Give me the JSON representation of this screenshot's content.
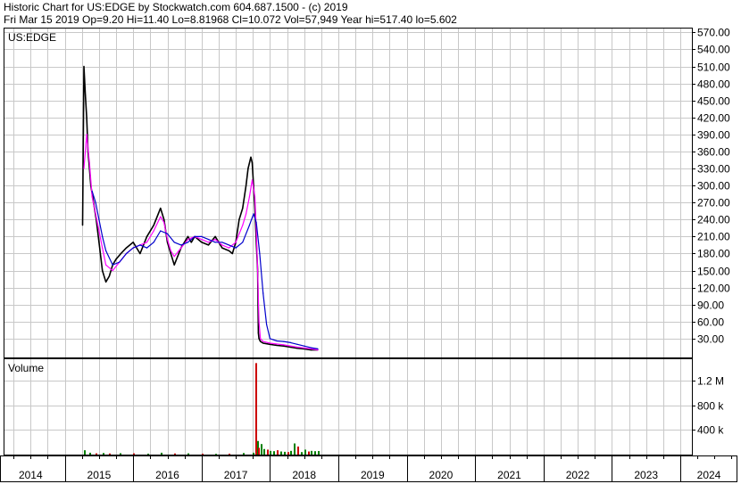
{
  "header": {
    "line1": "Historic Chart for US:EDGE by Stockwatch.com 604.687.1500 - (c) 2019",
    "line2": "Fri Mar 15 2019   Op=9.20   Hi=11.40   Lo=8.81968   Cl=10.072   Vol=57,949   Year hi=517.40   lo=5.602"
  },
  "chart_data": {
    "type": "line",
    "symbol_label": "US:EDGE",
    "volume_label": "Volume",
    "price_ticks": [
      "570.00",
      "540.00",
      "510.00",
      "480.00",
      "450.00",
      "420.00",
      "390.00",
      "360.00",
      "330.00",
      "300.00",
      "270.00",
      "240.00",
      "210.00",
      "180.00",
      "150.00",
      "120.00",
      "90.00",
      "60.00",
      "30.00"
    ],
    "volume_ticks": [
      "1.2 M",
      "800 k",
      "400 k"
    ],
    "year_labels": [
      "2014",
      "2015",
      "2016",
      "2017",
      "2018",
      "2019",
      "2020",
      "2021",
      "2022",
      "2023",
      "2024"
    ],
    "price_ylim": [
      0,
      585
    ],
    "volume_ylim": [
      0,
      1500000
    ],
    "grid": true,
    "colors": {
      "price": "#000000",
      "ma_short": "#ff00ff",
      "ma_long": "#0000cc",
      "vol_up": "#008000",
      "vol_down": "#cc0000",
      "grid": "#c8c8c8"
    },
    "series": [
      {
        "key": "close",
        "x": [
          2015.26,
          2015.28,
          2015.3,
          2015.32,
          2015.34,
          2015.36,
          2015.38,
          2015.42,
          2015.46,
          2015.5,
          2015.55,
          2015.6,
          2015.65,
          2015.7,
          2015.75,
          2015.82,
          2015.9,
          2016.0,
          2016.1,
          2016.2,
          2016.3,
          2016.4,
          2016.45,
          2016.5,
          2016.55,
          2016.6,
          2016.7,
          2016.8,
          2016.85,
          2016.9,
          2017.0,
          2017.1,
          2017.2,
          2017.3,
          2017.4,
          2017.45,
          2017.5,
          2017.55,
          2017.6,
          2017.65,
          2017.68,
          2017.72,
          2017.74,
          2017.76,
          2017.78,
          2017.8,
          2017.82,
          2017.83,
          2017.84,
          2017.86,
          2017.9,
          2018.0,
          2018.1,
          2018.2,
          2018.3,
          2018.4,
          2018.5,
          2018.6,
          2018.7
        ],
        "values": [
          230,
          510,
          460,
          420,
          360,
          330,
          300,
          270,
          240,
          200,
          150,
          130,
          140,
          160,
          170,
          180,
          190,
          200,
          180,
          210,
          230,
          260,
          240,
          200,
          180,
          160,
          190,
          210,
          200,
          210,
          200,
          195,
          210,
          190,
          185,
          180,
          200,
          240,
          260,
          300,
          330,
          350,
          340,
          300,
          260,
          200,
          150,
          40,
          30,
          25,
          22,
          20,
          18,
          17,
          15,
          13,
          12,
          10,
          10
        ]
      },
      {
        "key": "ma_short",
        "x": [
          2015.28,
          2015.32,
          2015.36,
          2015.4,
          2015.45,
          2015.5,
          2015.55,
          2015.6,
          2015.7,
          2015.8,
          2015.9,
          2016.0,
          2016.1,
          2016.2,
          2016.3,
          2016.4,
          2016.45,
          2016.5,
          2016.55,
          2016.6,
          2016.7,
          2016.8,
          2016.9,
          2017.0,
          2017.1,
          2017.2,
          2017.3,
          2017.4,
          2017.5,
          2017.6,
          2017.65,
          2017.7,
          2017.74,
          2017.78,
          2017.8,
          2017.82,
          2017.84,
          2017.86,
          2017.9,
          2018.0,
          2018.2,
          2018.4,
          2018.6,
          2018.7
        ],
        "values": [
          330,
          390,
          340,
          280,
          250,
          220,
          190,
          160,
          150,
          165,
          180,
          190,
          195,
          200,
          220,
          245,
          235,
          205,
          185,
          175,
          190,
          205,
          210,
          205,
          200,
          205,
          195,
          190,
          200,
          230,
          250,
          280,
          310,
          280,
          220,
          150,
          60,
          30,
          25,
          22,
          19,
          15,
          12,
          10
        ]
      },
      {
        "key": "ma_long",
        "x": [
          2015.4,
          2015.45,
          2015.5,
          2015.55,
          2015.6,
          2015.7,
          2015.8,
          2015.9,
          2016.0,
          2016.1,
          2016.2,
          2016.3,
          2016.4,
          2016.5,
          2016.6,
          2016.7,
          2016.8,
          2016.9,
          2017.0,
          2017.1,
          2017.2,
          2017.3,
          2017.4,
          2017.5,
          2017.6,
          2017.7,
          2017.76,
          2017.8,
          2017.85,
          2017.9,
          2017.95,
          2018.0,
          2018.1,
          2018.2,
          2018.3,
          2018.4,
          2018.5,
          2018.6,
          2018.7
        ],
        "values": [
          290,
          270,
          240,
          210,
          185,
          160,
          165,
          180,
          190,
          195,
          190,
          200,
          220,
          215,
          200,
          195,
          200,
          210,
          210,
          205,
          200,
          200,
          195,
          190,
          200,
          230,
          250,
          235,
          180,
          110,
          55,
          30,
          26,
          25,
          23,
          20,
          17,
          14,
          12
        ]
      }
    ],
    "volume": {
      "x": [
        2015.28,
        2015.36,
        2015.45,
        2015.55,
        2015.65,
        2015.8,
        2016.0,
        2016.2,
        2016.4,
        2016.6,
        2016.8,
        2017.0,
        2017.2,
        2017.4,
        2017.6,
        2017.75,
        2017.79,
        2017.81,
        2017.83,
        2017.86,
        2017.9,
        2017.95,
        2018.0,
        2018.05,
        2018.1,
        2018.15,
        2018.2,
        2018.25,
        2018.3,
        2018.35,
        2018.4,
        2018.45,
        2018.5,
        2018.55,
        2018.6,
        2018.65,
        2018.7
      ],
      "values": [
        70000,
        30000,
        20000,
        25000,
        18000,
        22000,
        20000,
        15000,
        30000,
        18000,
        20000,
        15000,
        12000,
        15000,
        25000,
        30000,
        1480000,
        220000,
        110000,
        170000,
        90000,
        80000,
        60000,
        55000,
        70000,
        50000,
        45000,
        40000,
        60000,
        180000,
        130000,
        40000,
        80000,
        50000,
        60000,
        55000,
        57949
      ],
      "up": [
        true,
        true,
        false,
        true,
        false,
        true,
        false,
        true,
        true,
        false,
        true,
        false,
        true,
        false,
        true,
        true,
        false,
        true,
        false,
        true,
        true,
        false,
        true,
        true,
        false,
        true,
        true,
        false,
        true,
        true,
        false,
        true,
        true,
        false,
        true,
        true,
        true
      ]
    }
  }
}
